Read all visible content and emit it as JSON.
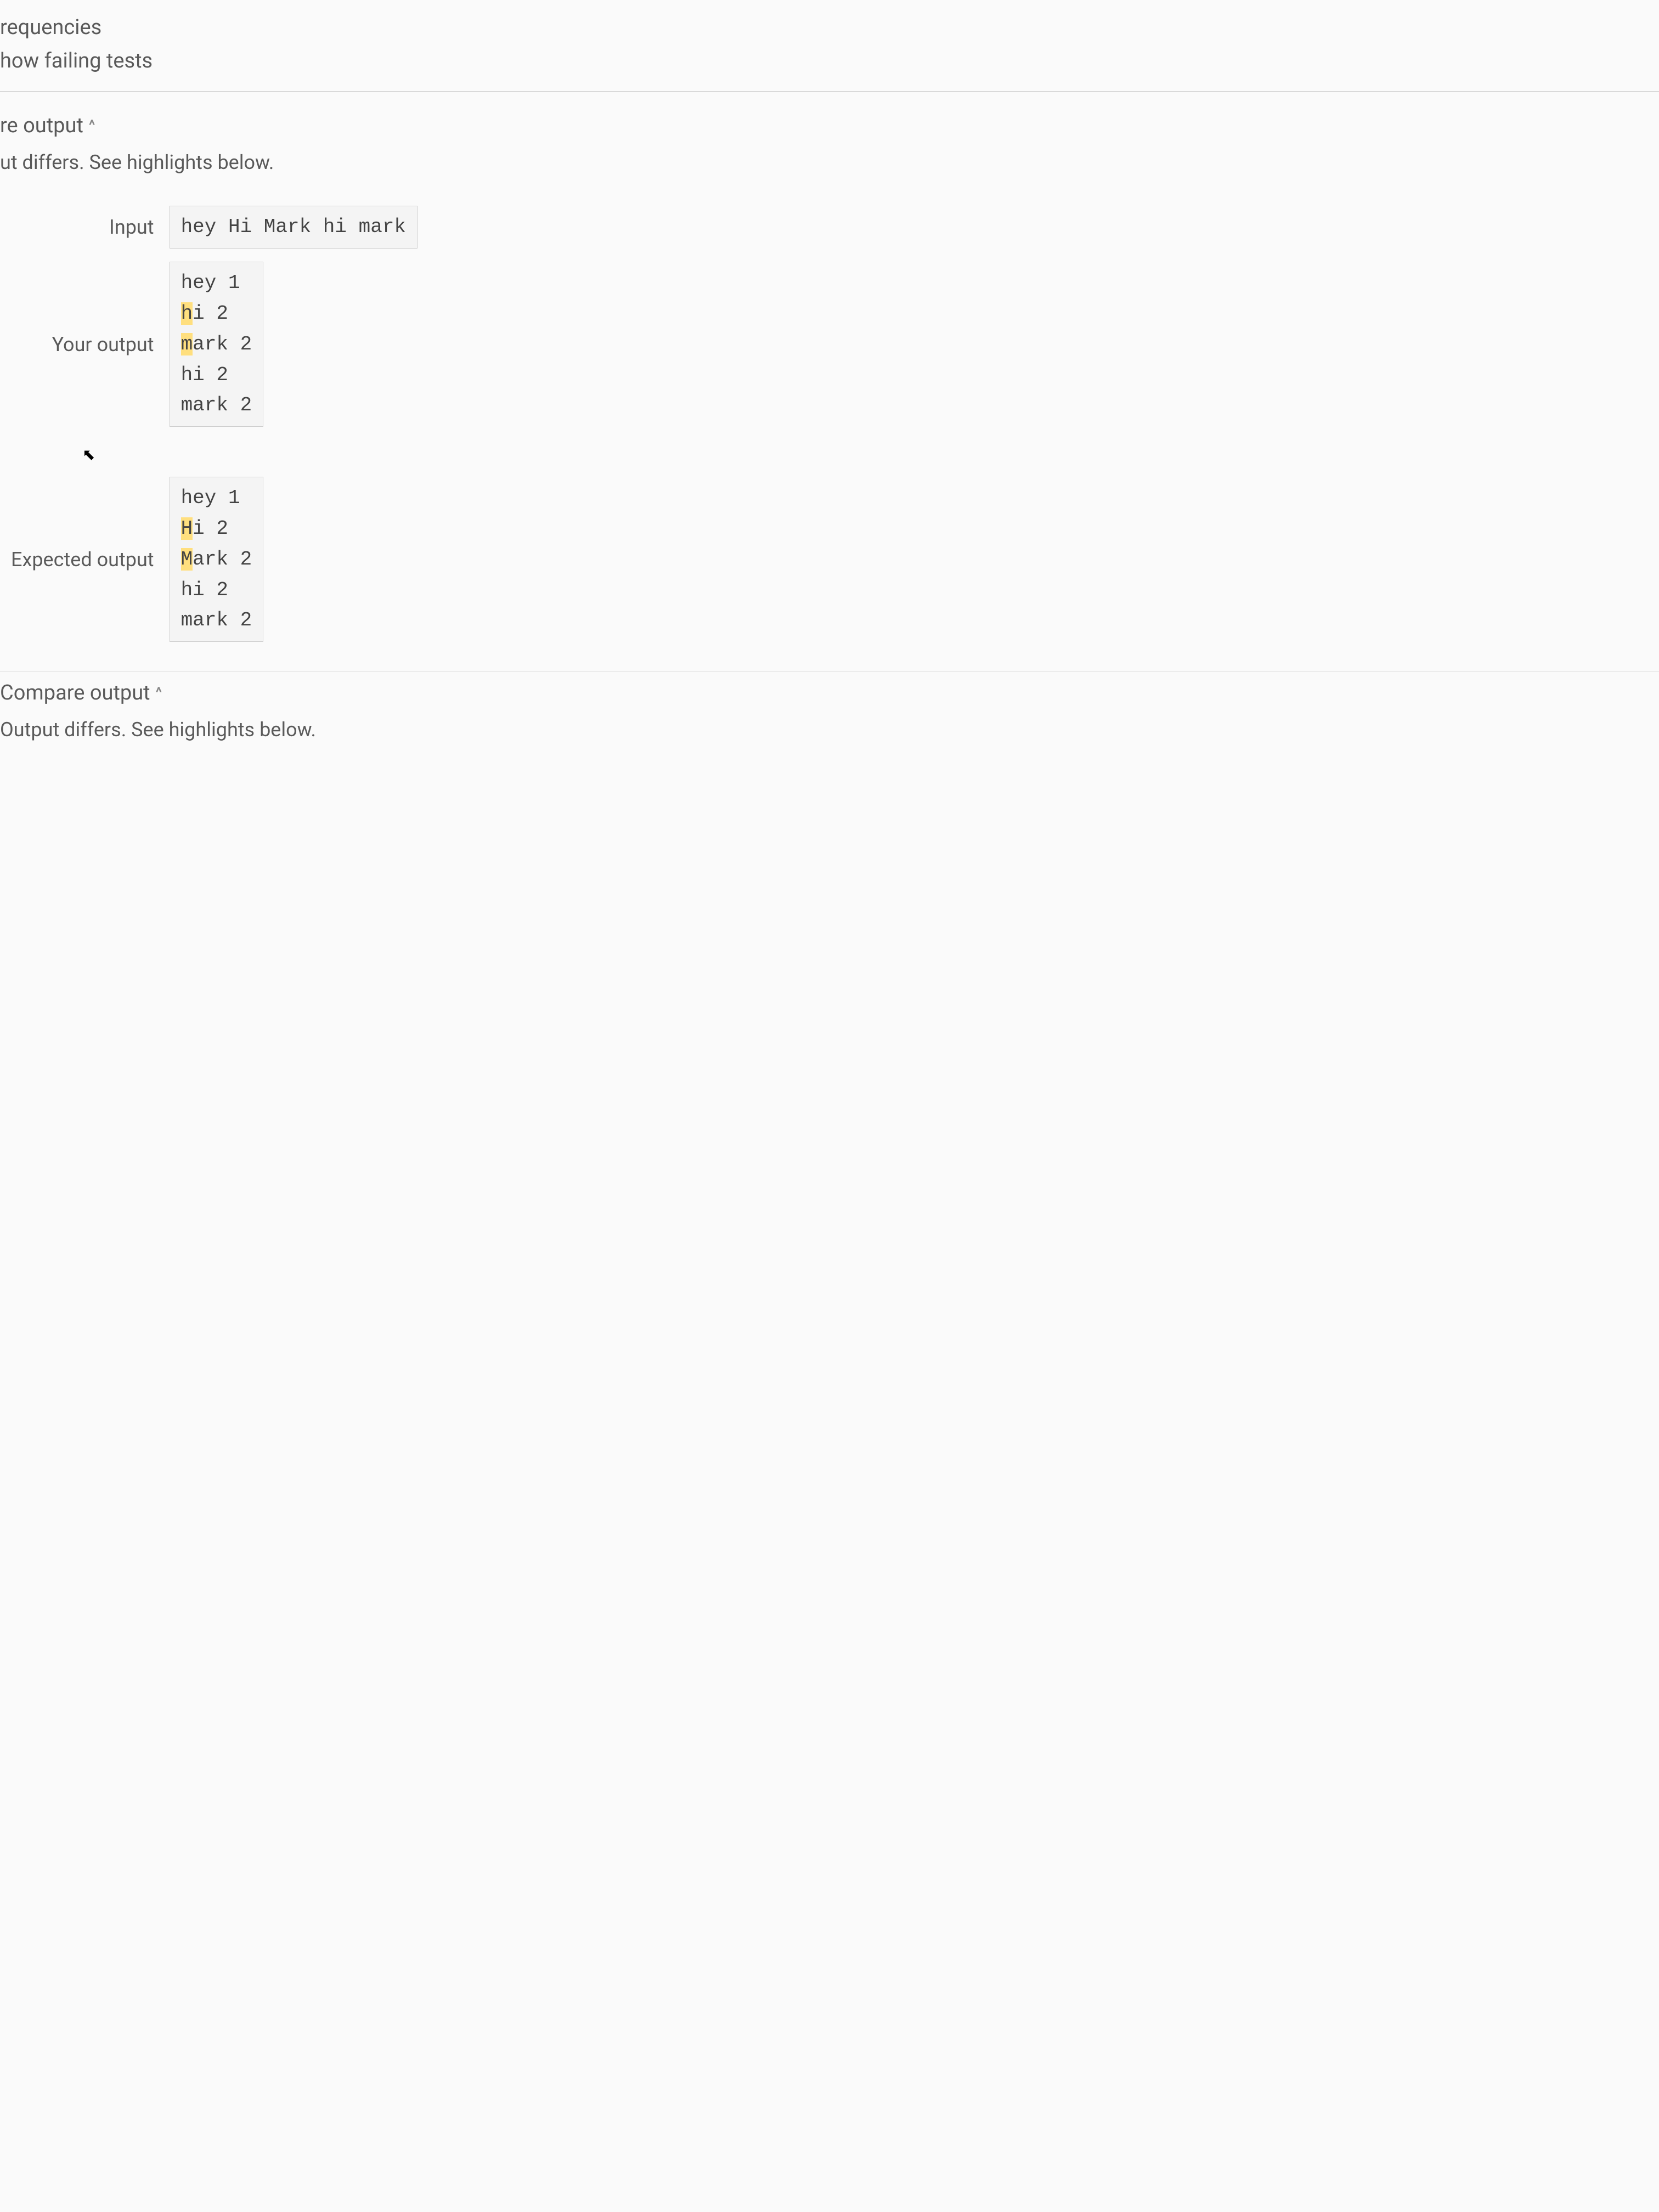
{
  "nav": {
    "item1": "requencies",
    "item2": "how failing tests"
  },
  "section1": {
    "header": "re output",
    "status": "ut differs. See highlights below.",
    "input_label": "Input",
    "input_value": "hey Hi Mark hi mark",
    "your_label": "Your output",
    "expected_label": "Expected output",
    "your_output": [
      {
        "pre": "",
        "hl": "",
        "post": "hey 1"
      },
      {
        "pre": "",
        "hl": "h",
        "post": "i 2"
      },
      {
        "pre": "",
        "hl": "m",
        "post": "ark 2"
      },
      {
        "pre": "",
        "hl": "",
        "post": "hi 2"
      },
      {
        "pre": "",
        "hl": "",
        "post": "mark 2"
      }
    ],
    "expected_output": [
      {
        "pre": "",
        "hl": "",
        "post": "hey 1"
      },
      {
        "pre": "",
        "hl": "H",
        "post": "i 2"
      },
      {
        "pre": "",
        "hl": "M",
        "post": "ark 2"
      },
      {
        "pre": "",
        "hl": "",
        "post": "hi 2"
      },
      {
        "pre": "",
        "hl": "",
        "post": "mark 2"
      }
    ]
  },
  "section2": {
    "header": "Compare output",
    "status": "Output differs. See highlights below."
  },
  "glyphs": {
    "chevron_up": "^",
    "cursor": "⬉"
  }
}
